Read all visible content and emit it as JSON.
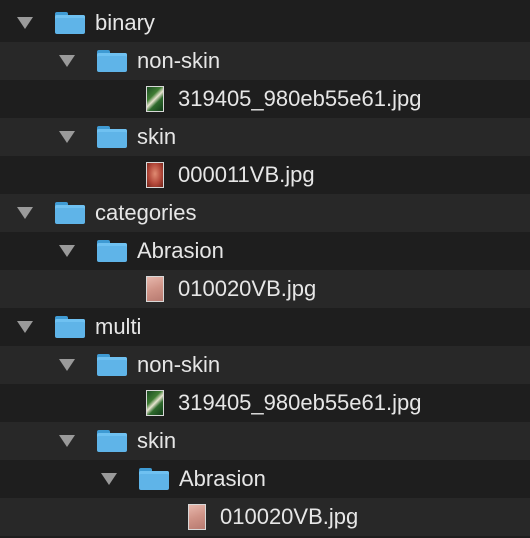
{
  "tree": {
    "items": [
      {
        "label": "binary",
        "kind": "folder"
      },
      {
        "label": "non-skin",
        "kind": "folder"
      },
      {
        "label": "319405_980eb55e61.jpg",
        "kind": "file",
        "thumbnail": "non-skin-thumbnail"
      },
      {
        "label": "skin",
        "kind": "folder"
      },
      {
        "label": "000011VB.jpg",
        "kind": "file",
        "thumbnail": "skin-thumbnail"
      },
      {
        "label": "categories",
        "kind": "folder"
      },
      {
        "label": "Abrasion",
        "kind": "folder"
      },
      {
        "label": "010020VB.jpg",
        "kind": "file",
        "thumbnail": "skin-thumbnail"
      },
      {
        "label": "multi",
        "kind": "folder"
      },
      {
        "label": "non-skin",
        "kind": "folder"
      },
      {
        "label": "319405_980eb55e61.jpg",
        "kind": "file",
        "thumbnail": "non-skin-thumbnail"
      },
      {
        "label": "skin",
        "kind": "folder"
      },
      {
        "label": "Abrasion",
        "kind": "folder"
      },
      {
        "label": "010020VB.jpg",
        "kind": "file",
        "thumbnail": "skin-thumbnail"
      }
    ]
  },
  "colors": {
    "background": "#1e1e1e",
    "row_alt": "#282828",
    "folder": "#5fb4e8",
    "text": "#e6e6e6",
    "disclosure_arrow": "#9a9a9a"
  }
}
